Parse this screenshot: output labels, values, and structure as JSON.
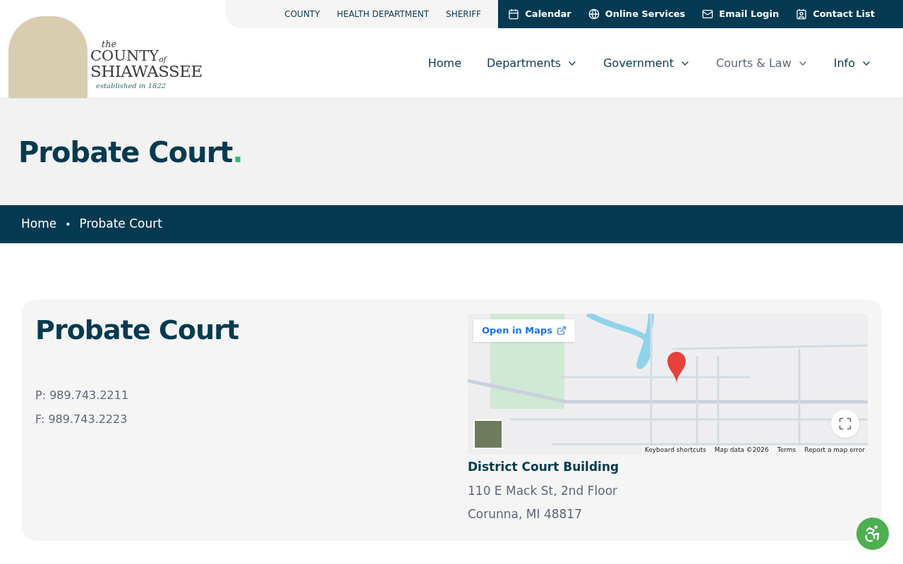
{
  "utility_links": [
    "COUNTY",
    "HEALTH DEPARTMENT",
    "SHERIFF"
  ],
  "quick_links": [
    {
      "kind": "calendar",
      "label": "Calendar"
    },
    {
      "kind": "globe",
      "label": "Online Services"
    },
    {
      "kind": "mail",
      "label": "Email Login"
    },
    {
      "kind": "contact",
      "label": "Contact List"
    }
  ],
  "logo": {
    "the": "the",
    "county": "COUNTY",
    "of": "of",
    "name": "SHIAWASSEE",
    "tagline": "established in 1822"
  },
  "nav": [
    {
      "label": "Home",
      "has_menu": false,
      "selected": false
    },
    {
      "label": "Departments",
      "has_menu": true,
      "selected": false
    },
    {
      "label": "Government",
      "has_menu": true,
      "selected": false
    },
    {
      "label": "Courts & Law",
      "has_menu": true,
      "selected": true
    },
    {
      "label": "Info",
      "has_menu": true,
      "selected": false
    }
  ],
  "hero": {
    "title": "Probate Court",
    "dot": "."
  },
  "breadcrumb": [
    {
      "label": "Home"
    },
    {
      "label": "Probate Court",
      "separator": "•"
    }
  ],
  "card": {
    "title": "Probate Court",
    "phones": [
      "P: 989.743.2211",
      "F: 989.743.2223"
    ],
    "map": {
      "open_label": "Open in Maps",
      "attribution": [
        "Keyboard shortcuts",
        "Map data ©2026",
        "Terms",
        "Report a map error"
      ]
    },
    "location": {
      "name": "District Court Building",
      "lines": [
        "110 E Mack St, 2nd Floor",
        "Corunna, MI 48817"
      ]
    }
  }
}
